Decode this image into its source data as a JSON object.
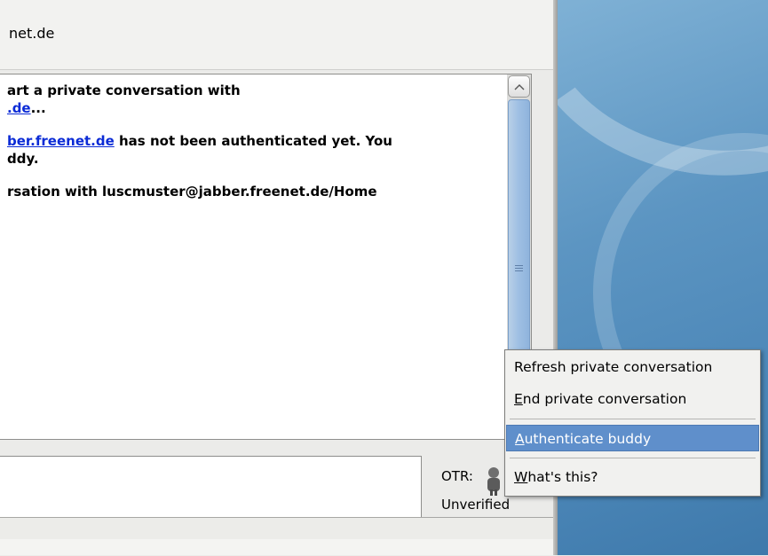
{
  "window": {
    "title": "net.de"
  },
  "conversation": {
    "messages": [
      {
        "text": "art a private conversation with"
      },
      {
        "link": ".de",
        "suffix": "..."
      },
      {
        "link": "ber.freenet.de",
        "suffix": " has not been authenticated yet.  You"
      },
      {
        "text": "ddy."
      },
      {
        "text": "rsation with luscmuster@jabber.freenet.de/Home"
      }
    ]
  },
  "otr": {
    "label": "OTR:",
    "status": "Unverified",
    "icon": "otr-person-icon"
  },
  "context_menu": {
    "items": [
      {
        "label_rest": "Refresh private conversation",
        "mnemonic": ""
      },
      {
        "mnemonic": "E",
        "label_rest": "nd private conversation"
      },
      {
        "mnemonic": "A",
        "label_rest": "uthenticate buddy",
        "selected": true
      },
      {
        "mnemonic": "W",
        "label_rest": "hat's this?"
      }
    ]
  },
  "colors": {
    "link": "#0b2bd6",
    "menu_highlight": "#5f8fcb",
    "desktop": "#4b86b7"
  }
}
